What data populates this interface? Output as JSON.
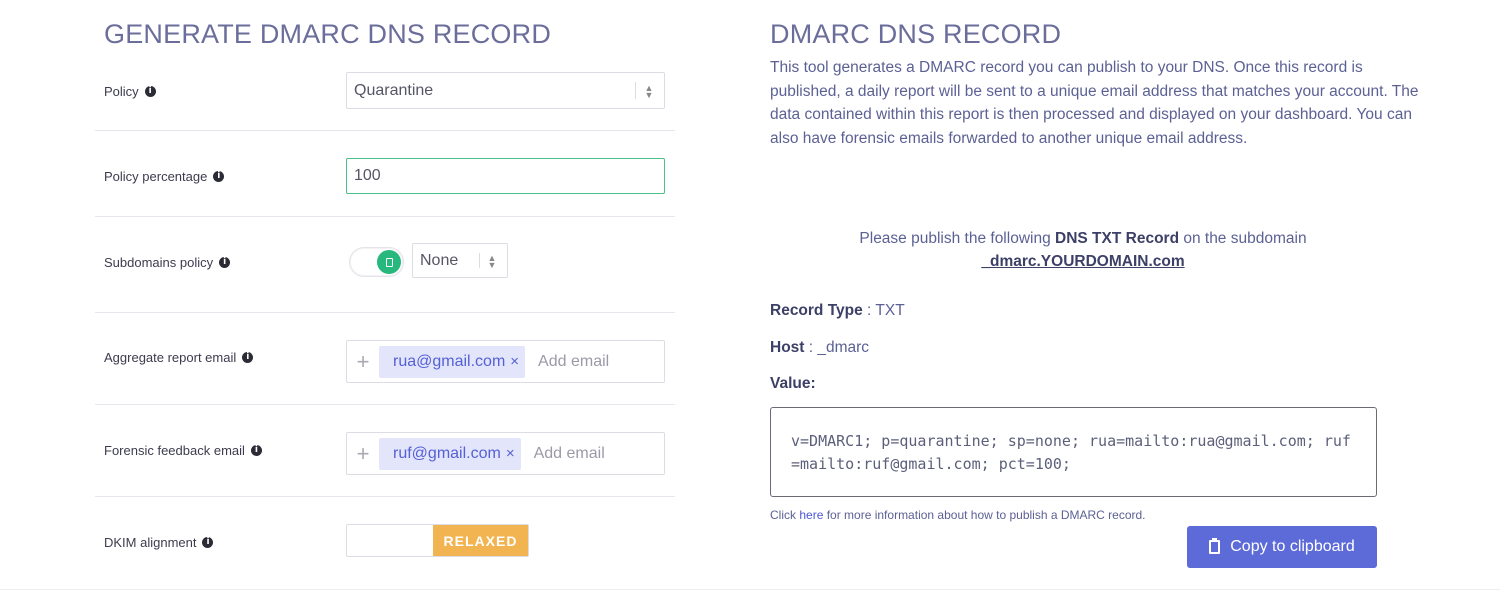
{
  "left": {
    "title": "GENERATE DMARC DNS RECORD",
    "policy": {
      "label": "Policy",
      "value": "Quarantine"
    },
    "policy_percentage": {
      "label": "Policy percentage",
      "value": "100"
    },
    "subdomains_policy": {
      "label": "Subdomains policy",
      "value": "None",
      "toggle_on": true
    },
    "aggregate_email": {
      "label": "Aggregate report email",
      "tag": "rua@gmail.com",
      "placeholder": "Add email"
    },
    "forensic_email": {
      "label": "Forensic feedback email",
      "tag": "ruf@gmail.com",
      "placeholder": "Add email"
    },
    "dkim": {
      "label": "DKIM alignment",
      "value": "RELAXED"
    }
  },
  "right": {
    "title": "DMARC DNS RECORD",
    "description": "This tool generates a DMARC record you can publish to your DNS. Once this record is published, a daily report will be sent to a unique email address that matches your account. The data contained within this report is then processed and displayed on your dashboard. You can also have forensic emails forwarded to another unique email address.",
    "publish_pre": "Please publish the following ",
    "publish_bold": "DNS TXT Record",
    "publish_post": " on the subdomain",
    "subdomain": "_dmarc.YOURDOMAIN.com",
    "record_type_label": "Record Type",
    "record_type_value": " : TXT",
    "host_label": "Host",
    "host_value": " : _dmarc",
    "value_label": "Value:",
    "value": "v=DMARC1; p=quarantine; sp=none; rua=mailto:rua@gmail.com; ruf=mailto:ruf@gmail.com; pct=100;",
    "help_pre": "Click ",
    "help_link": "here",
    "help_post": " for more information about how to publish a DMARC record.",
    "copy_label": "Copy to clipboard"
  },
  "colors": {
    "accent": "#5c6bd8",
    "toggle": "#28b77d",
    "relaxed": "#f2b450",
    "focus": "#4cc08a"
  }
}
